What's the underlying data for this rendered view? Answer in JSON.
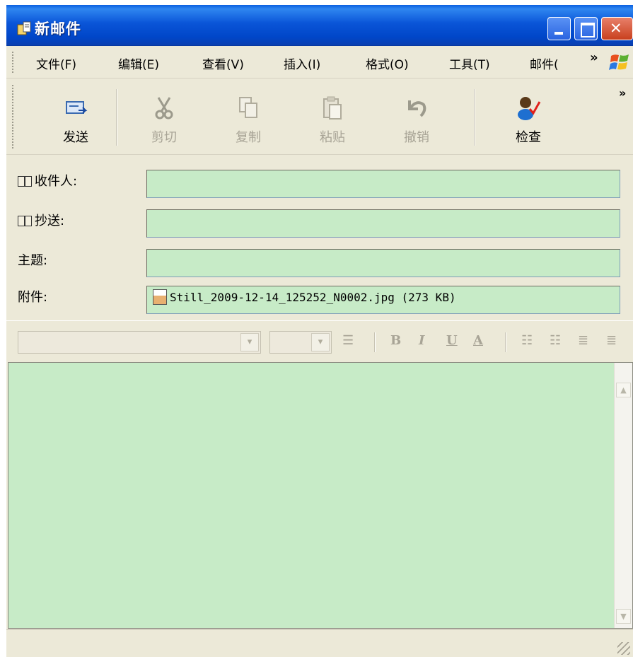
{
  "window": {
    "title": "新邮件"
  },
  "menu": {
    "items": [
      "文件(F)",
      "编辑(E)",
      "查看(V)",
      "插入(I)",
      "格式(O)",
      "工具(T)",
      "邮件("
    ],
    "overflow": "»"
  },
  "toolbar": {
    "send": "发送",
    "cut": "剪切",
    "copy": "复制",
    "paste": "粘贴",
    "undo": "撤销",
    "check": "检查",
    "overflow": "»"
  },
  "fields": {
    "to_label": "收件人:",
    "cc_label": "抄送:",
    "subject_label": "主题:",
    "attach_label": "附件:",
    "to_value": "",
    "cc_value": "",
    "subject_value": "",
    "attachment": "Still_2009-12-14_125252_N0002.jpg (273 KB)"
  },
  "format": {
    "bold": "B",
    "italic": "I",
    "underline": "U",
    "font_color": "A"
  },
  "colors": {
    "field_background": "#c7ebc7",
    "titlebar": "#0a55d8"
  }
}
